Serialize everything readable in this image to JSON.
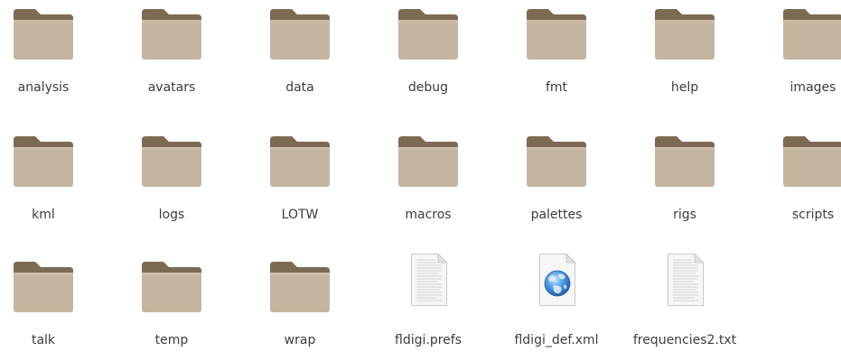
{
  "files": [
    {
      "name": "analysis",
      "kind": "folder"
    },
    {
      "name": "avatars",
      "kind": "folder"
    },
    {
      "name": "data",
      "kind": "folder"
    },
    {
      "name": "debug",
      "kind": "folder"
    },
    {
      "name": "fmt",
      "kind": "folder"
    },
    {
      "name": "help",
      "kind": "folder"
    },
    {
      "name": "images",
      "kind": "folder"
    },
    {
      "name": "kml",
      "kind": "folder"
    },
    {
      "name": "logs",
      "kind": "folder"
    },
    {
      "name": "LOTW",
      "kind": "folder"
    },
    {
      "name": "macros",
      "kind": "folder"
    },
    {
      "name": "palettes",
      "kind": "folder"
    },
    {
      "name": "rigs",
      "kind": "folder"
    },
    {
      "name": "scripts",
      "kind": "folder"
    },
    {
      "name": "talk",
      "kind": "folder"
    },
    {
      "name": "temp",
      "kind": "folder"
    },
    {
      "name": "wrap",
      "kind": "folder"
    },
    {
      "name": "fldigi.prefs",
      "kind": "text-document"
    },
    {
      "name": "fldigi_def.xml",
      "kind": "xml-document"
    },
    {
      "name": "frequencies2.txt",
      "kind": "text-document"
    }
  ],
  "colors": {
    "folder_tab": "#7d6a54",
    "folder_back": "#8b7761",
    "folder_front": "#c4b5a0",
    "folder_front_light": "#cbbda9",
    "label_text": "#3c3c3c"
  }
}
